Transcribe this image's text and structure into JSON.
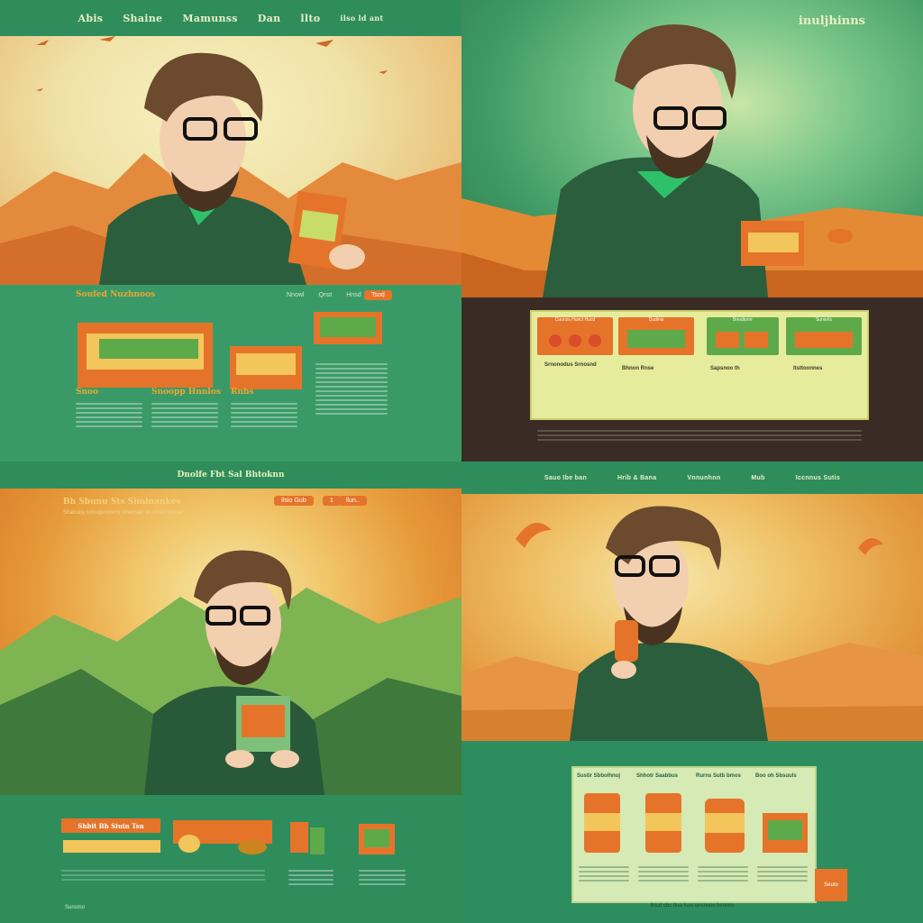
{
  "q1": {
    "nav": [
      "Abis",
      "Shaine",
      "Mamunss",
      "Dan",
      "llto",
      "ilso ld ant"
    ],
    "section_title": "Soufed Nuzhnoos",
    "section_nav": [
      "Nnowl",
      "Qnst",
      "Hnsd"
    ],
    "cta": "Tsod",
    "products": [
      "Snoo",
      "Snoopp Hnnlos",
      "Rnbs"
    ]
  },
  "q2": {
    "logo": "inuljhinns",
    "cards": [
      {
        "badge": "Cuunzs Hunct Hucd",
        "name": "Srnonodus Srnosnd"
      },
      {
        "badge": "Dudinis",
        "name": "Bhnon Rnse"
      },
      {
        "badge": "Bnodtonrr",
        "name": "Sapsnoo th"
      },
      {
        "badge": "Sunsnts",
        "name": "ltsttoonnes"
      }
    ]
  },
  "q3": {
    "header": "Dnolfe Fbt Sal Bhtoknn",
    "title": "Bh Sbunu Sts Siminankes",
    "subtitle": "Shatrany snnugunnnrcy ulnensan an unasnsulnan",
    "btn1": "Ilsio Gub",
    "btn2": "1",
    "btn3": "llun..",
    "product_label": "Shbit Bh Siuin Tsn",
    "footer": "Sunsmo"
  },
  "q4": {
    "nav": [
      "Sauo Ibe ban",
      "Hrib & Bana",
      "Vnnunhnn",
      "Mub",
      "Iccnnus Sutis"
    ],
    "columns": [
      "Sustir Sbbolhnuj",
      "Shhotr Saabbus",
      "Rurns Sutb bmos",
      "Boo oh Sbsuuls"
    ],
    "cta": "Seuto",
    "footer": "Ilncd cbc ttoa Isss unsnoos hsnnns"
  },
  "colors": {
    "green": "#2f8d5c",
    "orange": "#e5742a",
    "cream": "#f3e9b5",
    "coat": "#2b5e3c"
  }
}
